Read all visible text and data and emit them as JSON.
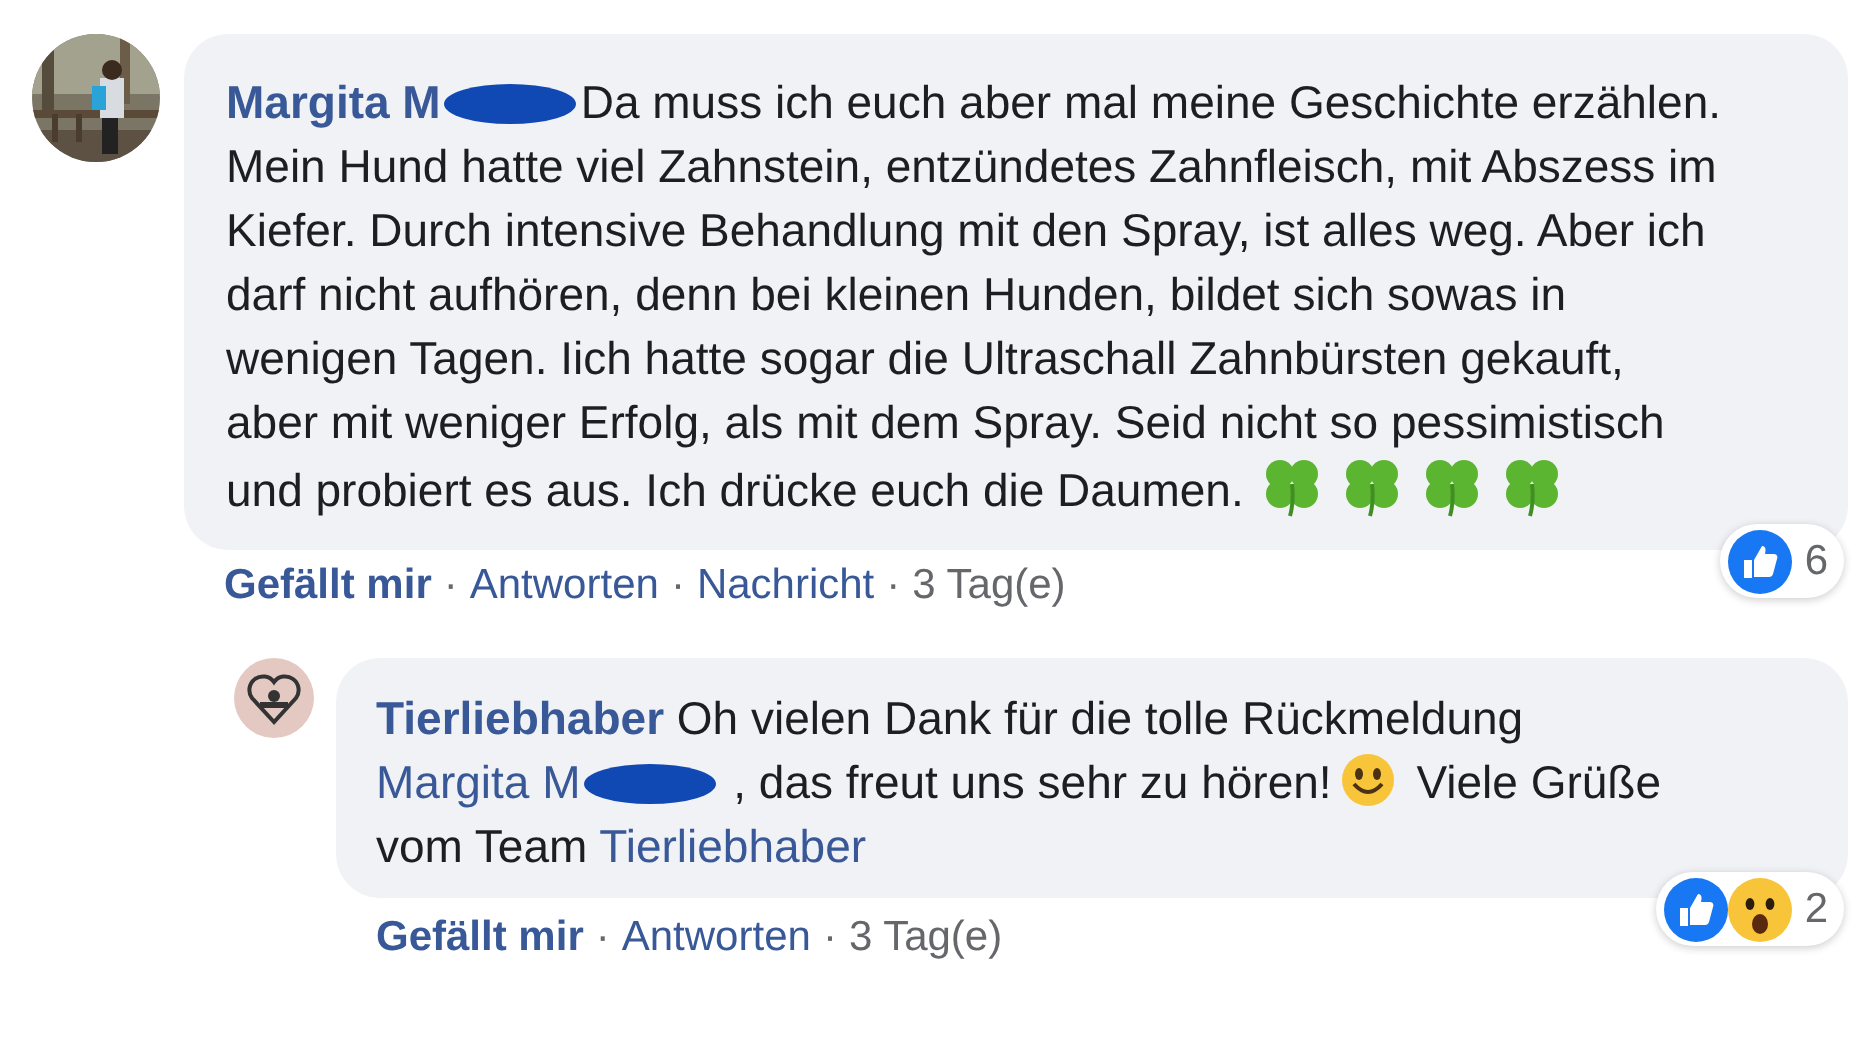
{
  "comments": [
    {
      "author": "Margita M",
      "author_redacted": true,
      "avatar": {
        "kind": "picture"
      },
      "body": [
        {
          "kind": "text",
          "text": "Da muss ich euch aber mal meine Geschichte erzählen. Mein Hund hatte viel Zahnstein, entzündetes Zahnfleisch, mit Abszess im Kiefer. Durch intensive Behandlung mit den Spray, ist alles weg. Aber ich darf nicht aufhören, denn bei kleinen Hunden, bildet sich sowas in wenigen Tagen. Iich hatte sogar die Ultraschall Zahnbürsten gekauft, aber mit weniger Erfolg, als mit dem Spray. Seid nicht so pessimistisch und probiert es aus. Ich drücke euch die Daumen."
        },
        {
          "kind": "clover"
        },
        {
          "kind": "clover"
        },
        {
          "kind": "clover"
        },
        {
          "kind": "clover"
        }
      ],
      "reactions": {
        "icons": [
          {
            "kind": "like"
          }
        ],
        "count": "6"
      },
      "actions": [
        "Gefällt mir",
        "Antworten",
        "Nachricht"
      ],
      "separator": "·",
      "time": "3 Tag(e)",
      "reply": false
    },
    {
      "author": "Tierliebhaber",
      "avatar": {
        "kind": "heart-logo"
      },
      "body": [
        {
          "kind": "text",
          "text": "Oh vielen Dank für die tolle Rückmeldung"
        },
        {
          "kind": "mention",
          "text": "Margita M",
          "redacted": true
        },
        {
          "kind": "text",
          "text": ", das freut uns sehr zu hören!"
        },
        {
          "kind": "smile"
        },
        {
          "kind": "text",
          "text": "Viele Grüße vom Team"
        },
        {
          "kind": "mention",
          "text": "Tierliebhaber",
          "redacted": false
        }
      ],
      "reactions": {
        "icons": [
          {
            "kind": "like"
          },
          {
            "kind": "wow"
          }
        ],
        "count": "2"
      },
      "actions": [
        "Gefällt mir",
        "Antworten"
      ],
      "separator": "·",
      "time": "3 Tag(e)",
      "reply": true
    }
  ]
}
